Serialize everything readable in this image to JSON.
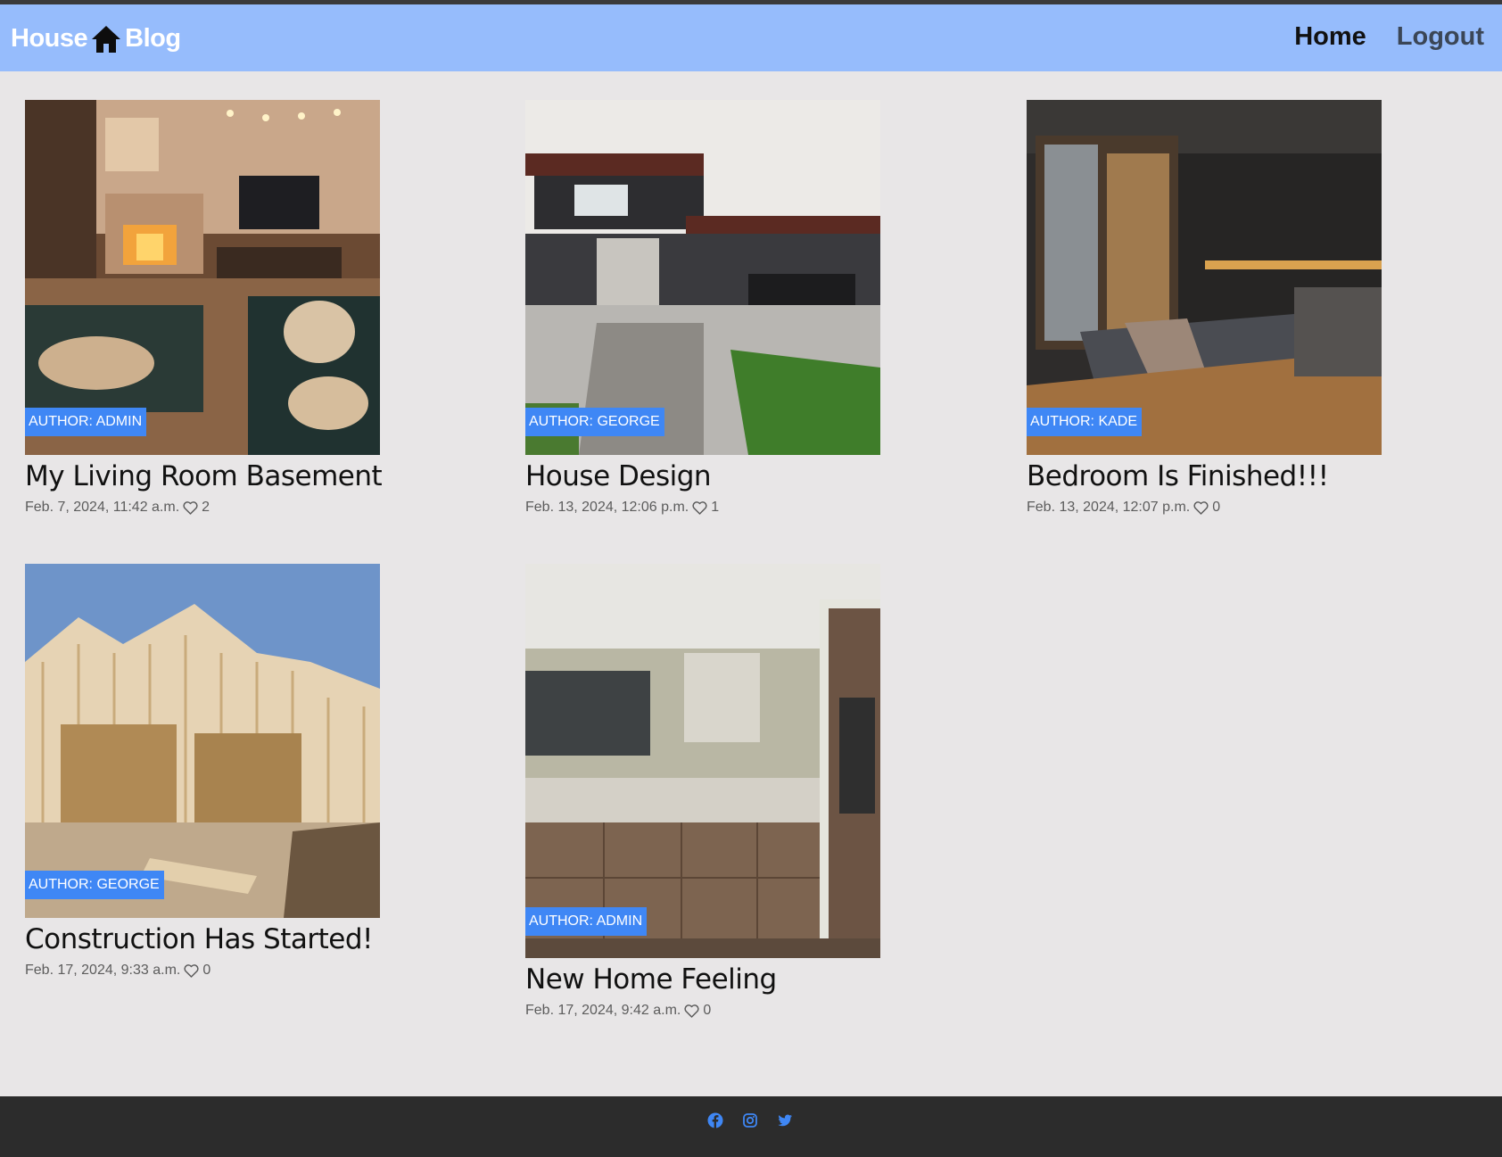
{
  "navbar": {
    "brand_left": "House",
    "brand_right": "Blog",
    "brand_icon": "house-icon",
    "links": [
      {
        "label": "Home",
        "active": true
      },
      {
        "label": "Logout",
        "active": false
      }
    ]
  },
  "posts": [
    {
      "author": "AUTHOR: ADMIN",
      "title": "My Living Room Basement",
      "date": "Feb. 7, 2024, 11:42 a.m.",
      "likes": "2",
      "image": "living-room-photo"
    },
    {
      "author": "AUTHOR: GEORGE",
      "title": "House Design",
      "date": "Feb. 13, 2024, 12:06 p.m.",
      "likes": "1",
      "image": "modern-house-photo"
    },
    {
      "author": "AUTHOR: KADE",
      "title": "Bedroom Is Finished!!!",
      "date": "Feb. 13, 2024, 12:07 p.m.",
      "likes": "0",
      "image": "bedroom-photo"
    },
    {
      "author": "AUTHOR: GEORGE",
      "title": "Construction Has Started!",
      "date": "Feb. 17, 2024, 9:33 a.m.",
      "likes": "0",
      "image": "construction-photo"
    },
    {
      "author": "AUTHOR: ADMIN",
      "title": "New Home Feeling",
      "date": "Feb. 17, 2024, 9:42 a.m.",
      "likes": "0",
      "image": "kitchen-photo"
    }
  ],
  "footer": {
    "social_icons": [
      "facebook-icon",
      "instagram-icon",
      "twitter-icon"
    ],
    "icon_color": "#3f87f5"
  },
  "colors": {
    "navbar_bg": "#96bcfc",
    "badge_bg": "#3f87f5",
    "page_bg": "#e8e6e7",
    "footer_bg": "#2c2c2c"
  }
}
